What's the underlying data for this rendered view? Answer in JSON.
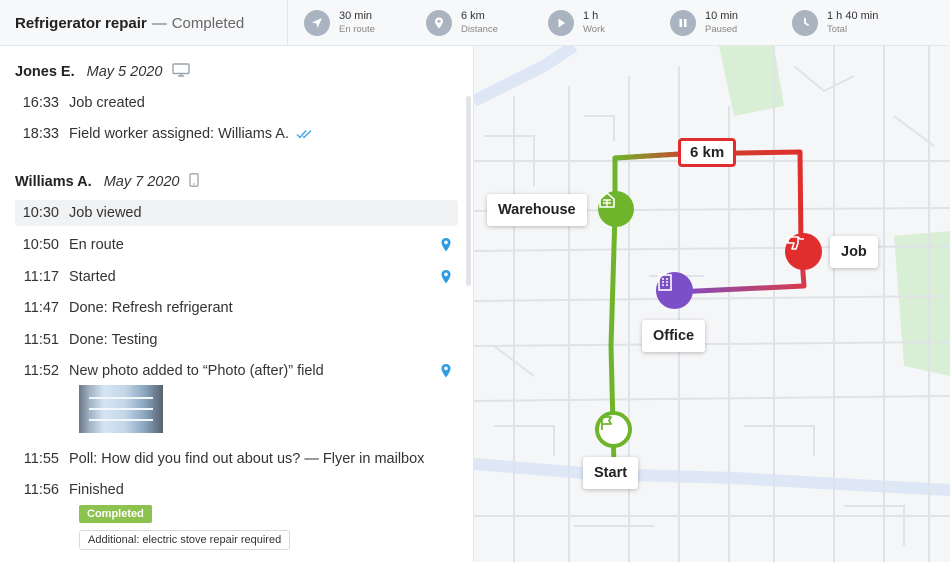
{
  "header": {
    "title": "Refrigerator repair",
    "separator": "—",
    "status": "Completed",
    "stats": [
      {
        "icon": "navigation-arrow-icon",
        "value": "30 min",
        "label": "En route"
      },
      {
        "icon": "location-pin-icon",
        "value": "6 km",
        "label": "Distance"
      },
      {
        "icon": "play-icon",
        "value": "1 h",
        "label": "Work"
      },
      {
        "icon": "pause-icon",
        "value": "10 min",
        "label": "Paused"
      },
      {
        "icon": "clock-icon",
        "value": "1 h 40 min",
        "label": "Total"
      }
    ]
  },
  "timeline": {
    "groups": [
      {
        "person": "Jones E.",
        "date": "May 5 2020",
        "device_icon": "desktop-icon",
        "events": [
          {
            "time": "16:33",
            "text": "Job created"
          },
          {
            "time": "18:33",
            "text": "Field worker assigned: Williams A.",
            "icon": "double-check-icon"
          }
        ]
      },
      {
        "person": "Williams A.",
        "date": "May 7 2020",
        "device_icon": "mobile-icon",
        "events": [
          {
            "time": "10:30",
            "text": "Job viewed",
            "highlighted": true
          },
          {
            "time": "10:50",
            "text": "En route",
            "icon": "location-pin-icon"
          },
          {
            "time": "11:17",
            "text": "Started",
            "icon": "location-pin-icon"
          },
          {
            "time": "11:47",
            "text": "Done: Refresh refrigerant"
          },
          {
            "time": "11:51",
            "text": "Done: Testing"
          },
          {
            "time": "11:52",
            "text": "New photo added to “Photo (after)” field",
            "icon": "location-pin-icon"
          },
          {
            "time": "11:55",
            "text": "Poll: How did you find out about us? — Flyer in mailbox"
          },
          {
            "time": "11:56",
            "text": "Finished",
            "badge": "Completed",
            "note": "Additional: electric stove repair required"
          }
        ]
      }
    ]
  },
  "map": {
    "distance_label": "6 km",
    "places": {
      "warehouse": "Warehouse",
      "job": "Job",
      "office": "Office",
      "start": "Start"
    },
    "colors": {
      "route_green": "#6fb52c",
      "route_red": "#e02e2e",
      "office_purple": "#7c4fc7"
    }
  }
}
